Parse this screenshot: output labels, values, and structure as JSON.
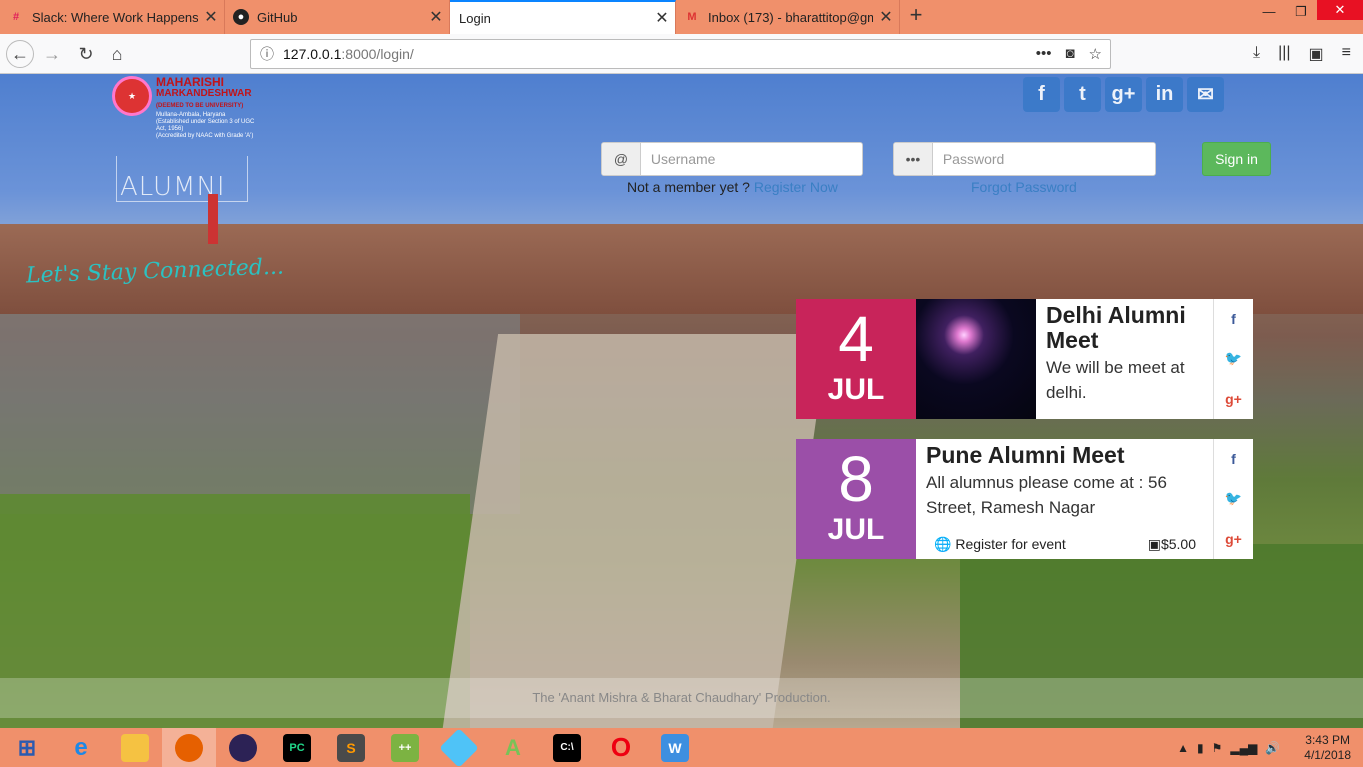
{
  "browser": {
    "tabs": [
      {
        "title": "Slack: Where Work Happens",
        "icon": "slack-icon",
        "active": false
      },
      {
        "title": "GitHub",
        "icon": "github-icon",
        "active": false
      },
      {
        "title": "Login",
        "icon": "",
        "active": true
      },
      {
        "title": "Inbox (173) - bharattitop@gma",
        "icon": "gmail-icon",
        "active": false
      }
    ],
    "new_tab_label": "+",
    "url_host": "127.0.0.1",
    "url_path": ":8000/login/"
  },
  "site": {
    "logo_title_line1": "MAHARISHI",
    "logo_title_line2": "MARKANDESHWAR",
    "logo_title_line3": "(DEEMED TO BE UNIVERSITY)",
    "logo_location": "Mullana-Ambala, Haryana",
    "logo_established": "(Established under Section 3 of UGC Act, 1956)",
    "logo_accredited": "(Accredited by NAAC with Grade 'A')",
    "alumni_label": "ALUMNI",
    "tagline": "Let's Stay Connected...",
    "social_icons": [
      "facebook-icon",
      "twitter-icon",
      "google-plus-icon",
      "linkedin-icon",
      "email-icon"
    ]
  },
  "login": {
    "username_addon": "@",
    "username_placeholder": "Username",
    "password_addon": "•••",
    "password_placeholder": "Password",
    "signin_label": "Sign in",
    "not_member_text": "Not a member yet ?",
    "register_link": "Register Now",
    "forgot_link": "Forgot Password"
  },
  "events": [
    {
      "day": "4",
      "month": "JUL",
      "title": "Delhi Alumni Meet",
      "description": "We will be meet at delhi.",
      "color": "#c8245a",
      "has_image": true
    },
    {
      "day": "8",
      "month": "JUL",
      "title": "Pune Alumni Meet",
      "description": "All alumnus please come at : 56 Street, Ramesh Nagar",
      "color": "#9b4fa8",
      "has_image": false,
      "register_label": "Register for event",
      "price": "$5.00"
    }
  ],
  "footer": {
    "credit": "The 'Anant Mishra & Bharat Chaudhary' Production."
  },
  "taskbar": {
    "time": "3:43 PM",
    "date": "4/1/2018",
    "apps": [
      "windows-start-icon",
      "internet-explorer-icon",
      "file-explorer-icon",
      "firefox-icon",
      "eclipse-icon",
      "pycharm-icon",
      "sublime-icon",
      "notepad-icon",
      "app-icon",
      "android-studio-icon",
      "cmd-icon",
      "opera-icon",
      "wps-icon"
    ]
  }
}
